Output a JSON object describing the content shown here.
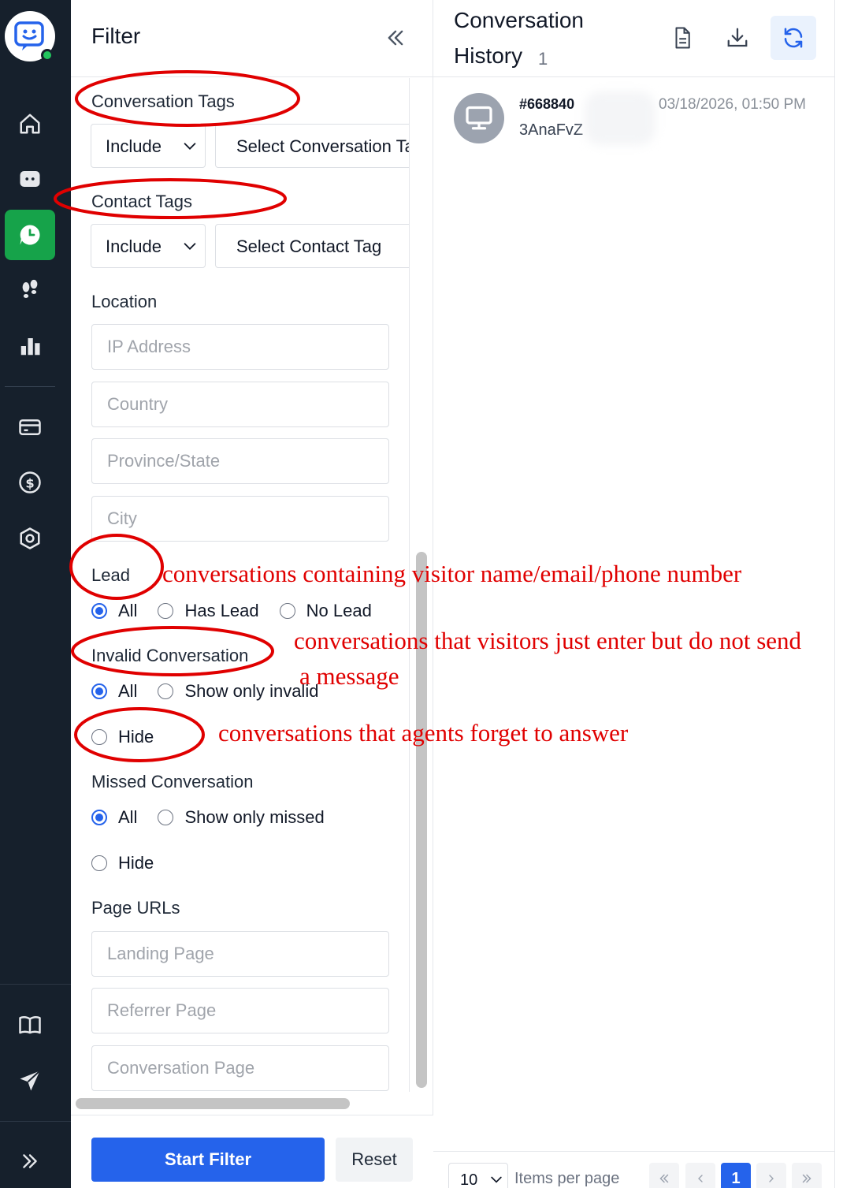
{
  "colors": {
    "rail_bg": "#16202c",
    "rail_active": "#16a34a",
    "primary": "#2563eb",
    "annotation": "#e00000",
    "status_online": "#22c55e"
  },
  "rail": {
    "items": [
      {
        "name": "home",
        "icon": "home-icon"
      },
      {
        "name": "chat",
        "icon": "chat-bubble-icon"
      },
      {
        "name": "history",
        "icon": "history-clock-icon",
        "active": true
      },
      {
        "name": "visitors",
        "icon": "footprints-icon"
      },
      {
        "name": "analytics",
        "icon": "bar-chart-icon"
      },
      {
        "name": "billing",
        "icon": "credit-card-icon"
      },
      {
        "name": "pricing",
        "icon": "dollar-circle-icon"
      },
      {
        "name": "settings",
        "icon": "hexagon-settings-icon"
      },
      {
        "name": "docs",
        "icon": "book-icon"
      },
      {
        "name": "send",
        "icon": "paper-plane-icon"
      },
      {
        "name": "expand",
        "icon": "double-chevron-right-icon"
      }
    ]
  },
  "filter": {
    "title": "Filter",
    "conversation_tags": {
      "label": "Conversation Tags",
      "mode": "Include",
      "placeholder": "Select Conversation Tag"
    },
    "contact_tags": {
      "label": "Contact Tags",
      "mode": "Include",
      "placeholder": "Select Contact Tag"
    },
    "location": {
      "label": "Location",
      "ip_placeholder": "IP Address",
      "country_placeholder": "Country",
      "province_placeholder": "Province/State",
      "city_placeholder": "City"
    },
    "lead": {
      "label": "Lead",
      "options": [
        "All",
        "Has Lead",
        "No Lead"
      ],
      "selected": "All"
    },
    "invalid_conversation": {
      "label": "Invalid Conversation",
      "options": [
        "All",
        "Show only invalid",
        "Hide"
      ],
      "selected": "All"
    },
    "missed_conversation": {
      "label": "Missed Conversation",
      "options": [
        "All",
        "Show only missed",
        "Hide"
      ],
      "selected": "All"
    },
    "page_urls": {
      "label": "Page URLs",
      "landing_placeholder": "Landing Page",
      "referrer_placeholder": "Referrer Page",
      "conversation_placeholder": "Conversation Page"
    },
    "start_button": "Start Filter",
    "reset_button": "Reset"
  },
  "history": {
    "title_line1": "Conversation",
    "title_line2": "History",
    "count": "1",
    "actions": [
      "file-text-icon",
      "download-icon",
      "refresh-icon"
    ],
    "items": [
      {
        "id": "#668840",
        "subtitle": "3AnaFvZ",
        "time": "03/18/2026, 01:50 PM",
        "icon": "desktop-monitor-icon"
      }
    ],
    "pagination": {
      "page_size": "10",
      "per_page_label": "Items per page",
      "current_page": "1"
    }
  },
  "annotations": {
    "lead": "conversations containing  visitor name/email/phone number",
    "invalid_line1": "conversations that visitors just enter but do not send",
    "invalid_line2": "a message",
    "hide": "conversations that agents forget to answer"
  }
}
